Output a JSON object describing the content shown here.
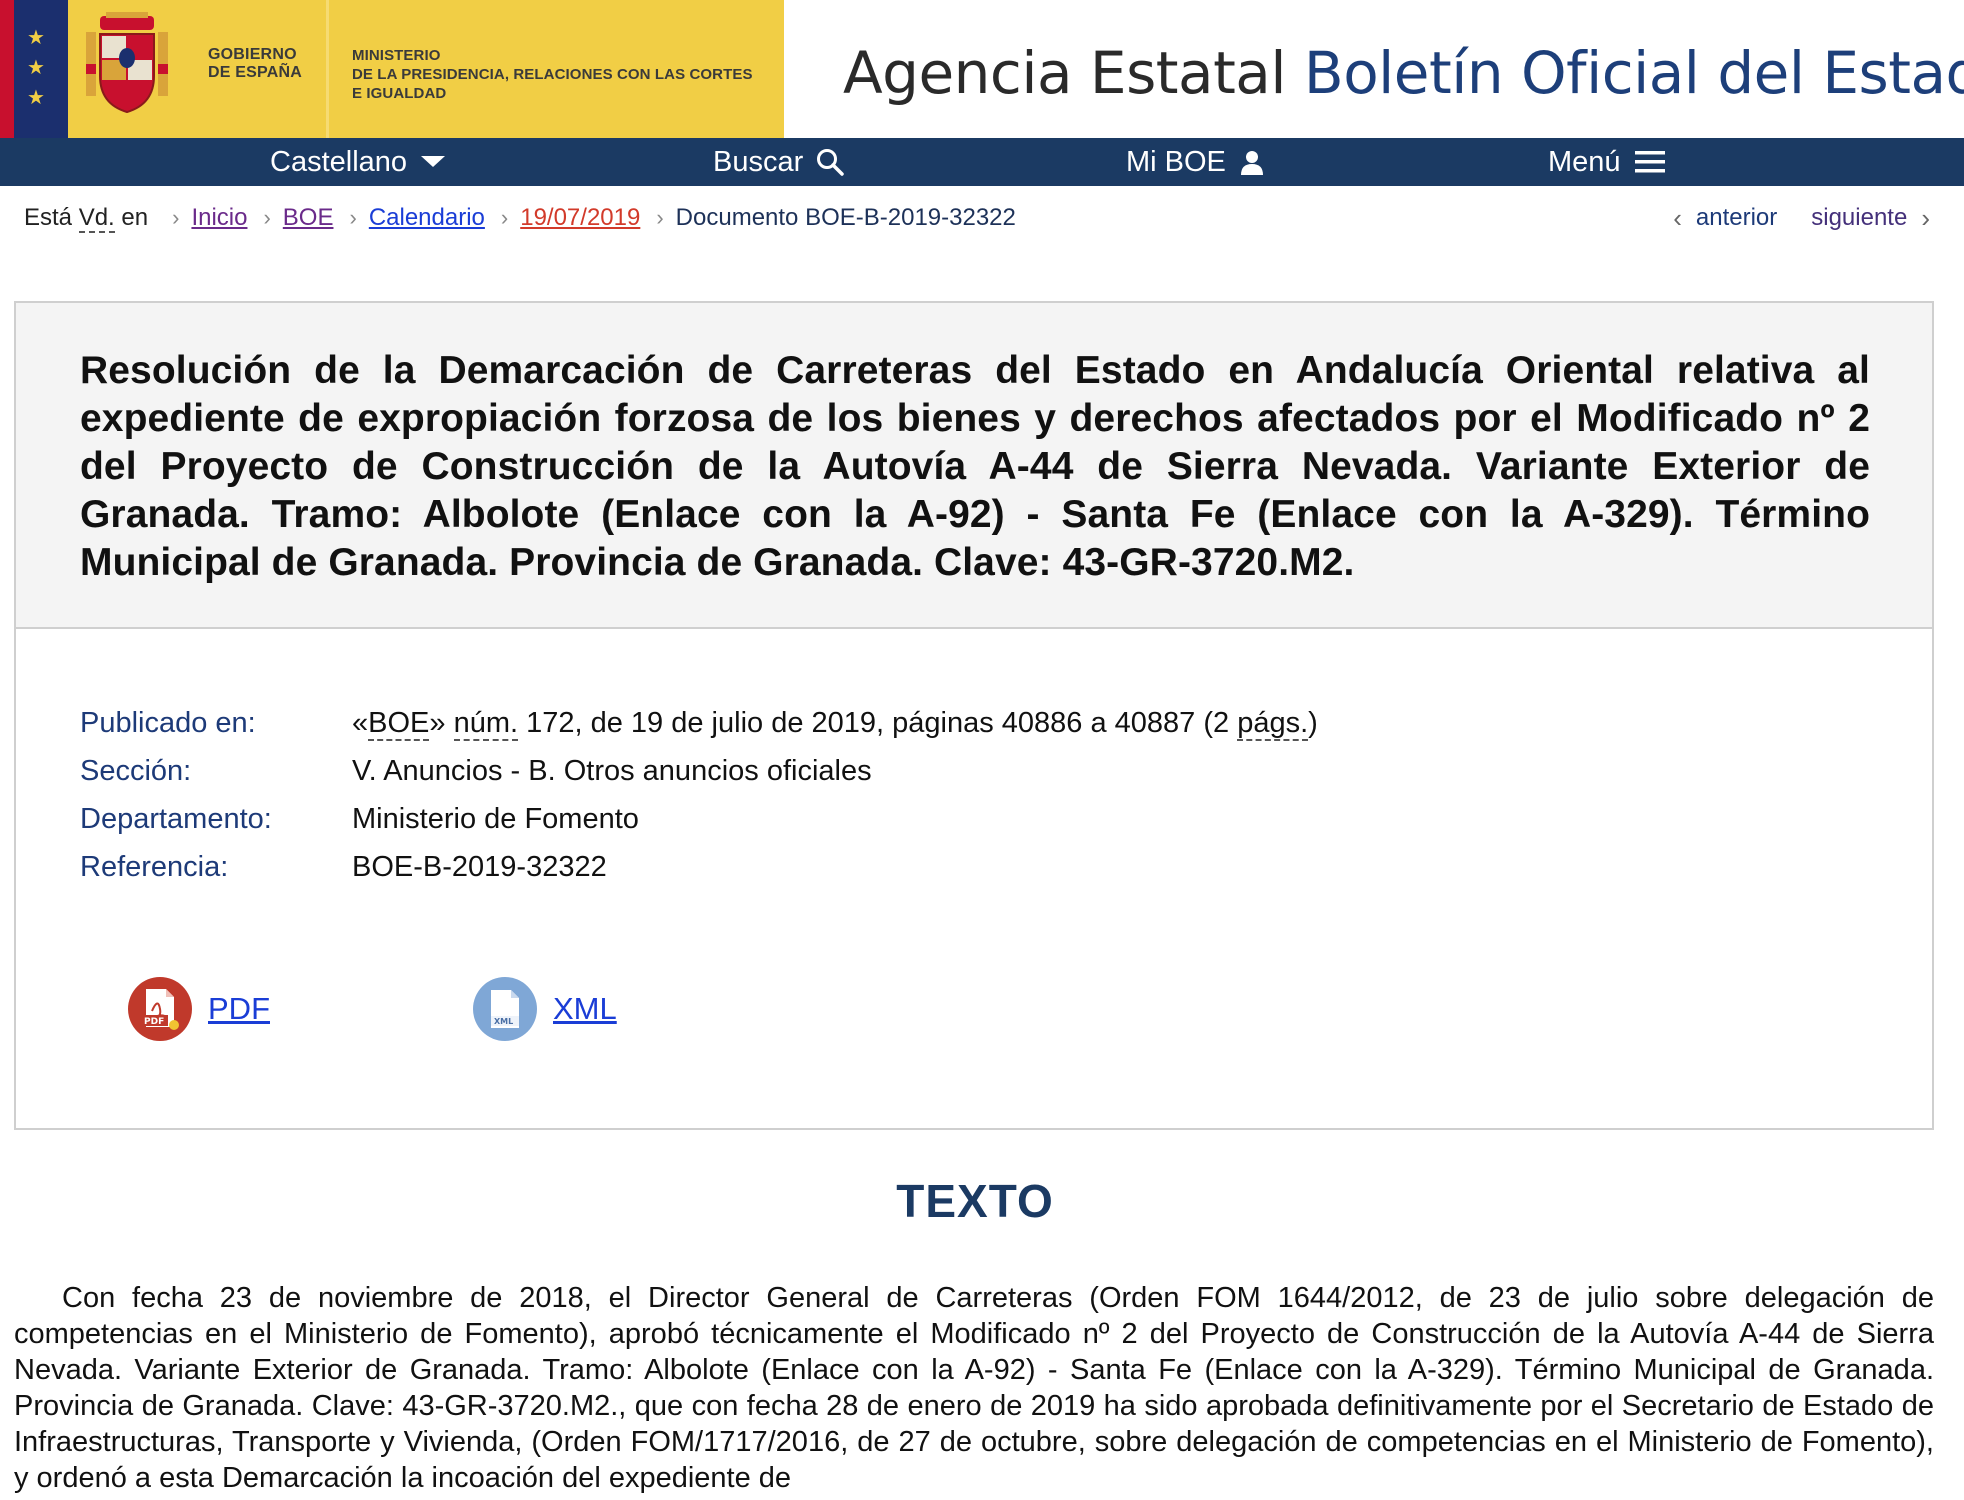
{
  "header": {
    "gov_line1": "GOBIERNO",
    "gov_line2": "DE ESPAÑA",
    "ministry_line1": "MINISTERIO",
    "ministry_line2": "DE LA PRESIDENCIA, RELACIONES CON LAS CORTES",
    "ministry_line3": "E IGUALDAD",
    "agency_prefix": "Agencia Estatal",
    "agency_name": "Boletín Oficial del Estado"
  },
  "nav": {
    "language": "Castellano",
    "search": "Buscar",
    "my_boe": "Mi BOE",
    "menu": "Menú"
  },
  "breadcrumb": {
    "lead_before": "Está",
    "lead_abbr": "Vd.",
    "lead_after": "en",
    "items": [
      "Inicio",
      "BOE",
      "Calendario",
      "19/07/2019",
      "Documento BOE-B-2019-32322"
    ]
  },
  "pager": {
    "prev": "anterior",
    "next": "siguiente"
  },
  "document": {
    "title": "Resolución de la Demarcación de Carreteras del Estado en Andalucía Oriental relativa al expediente de expropiación forzosa de los bienes y derechos afectados por el Modificado nº 2 del Proyecto de Construcción de la Autovía A-44 de Sierra Nevada. Variante Exterior de Granada. Tramo: Albolote (Enlace con la A-92) - Santa Fe (Enlace con la A-329). Término Municipal de Granada. Provincia de Granada. Clave: 43-GR-3720.M2.",
    "meta": {
      "published_label": "Publicado en:",
      "published_pre": "«",
      "published_boe": "BOE",
      "published_mid": "» ",
      "published_num": "núm.",
      "published_rest": " 172, de 19 de julio de 2019, páginas 40886 a 40887 (2 ",
      "published_pags": "págs.",
      "published_end": ")",
      "section_label": "Sección:",
      "section_value": "V. Anuncios - B. Otros anuncios oficiales",
      "department_label": "Departamento:",
      "department_value": "Ministerio de Fomento",
      "reference_label": "Referencia:",
      "reference_value": "BOE-B-2019-32322"
    },
    "downloads": {
      "pdf_label": "PDF",
      "pdf_icon_text": "PDF",
      "xml_label": "XML",
      "xml_icon_text": "XML"
    }
  },
  "texto": {
    "heading": "TEXTO",
    "paragraph": "Con fecha 23 de noviembre de 2018, el Director General de Carreteras (Orden FOM 1644/2012, de 23 de julio sobre delegación de competencias en el Ministerio de Fomento), aprobó técnicamente el Modificado nº 2 del Proyecto de Construcción de la Autovía A-44 de Sierra Nevada. Variante Exterior de Granada. Tramo: Albolote (Enlace con la A-92) - Santa Fe (Enlace con la A-329). Término Municipal de Granada. Provincia de Granada. Clave: 43-GR-3720.M2., que con fecha 28 de enero de 2019 ha sido aprobada definitivamente por el Secretario de Estado de Infraestructuras, Transporte y Vivienda, (Orden FOM/1717/2016, de 27 de octubre, sobre delegación de competencias en el Ministerio de Fomento), y ordenó a esta Demarcación la incoación del expediente de"
  },
  "colors": {
    "navbar": "#1b3a63",
    "gov_yellow": "#f1ce45",
    "link_blue": "#1a3dd6",
    "label_blue": "#1d3a78",
    "pdf_red": "#c0392b",
    "xml_blue": "#7fa7d6"
  },
  "icons": {
    "language": "chevron-down-icon",
    "search": "search-icon",
    "user": "user-icon",
    "menu": "hamburger-icon",
    "pdf": "pdf-file-icon",
    "xml": "xml-file-icon"
  }
}
